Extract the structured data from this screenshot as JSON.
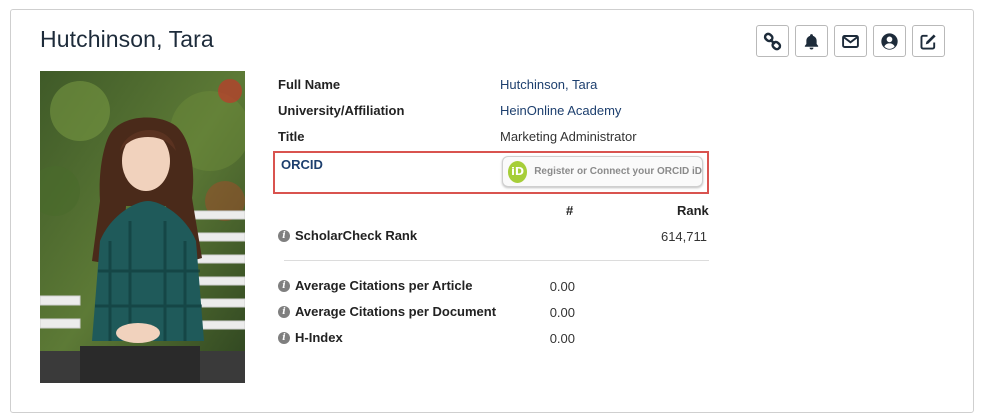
{
  "profile": {
    "name": "Hutchinson, Tara"
  },
  "actions": [
    {
      "icon": "link-icon",
      "label": "Link"
    },
    {
      "icon": "bell-icon",
      "label": "Alerts"
    },
    {
      "icon": "envelope-icon",
      "label": "Email"
    },
    {
      "icon": "user-circle-icon",
      "label": "Profile"
    },
    {
      "icon": "edit-icon",
      "label": "Edit"
    }
  ],
  "fields": {
    "full_name_label": "Full Name",
    "full_name_value": "Hutchinson, Tara",
    "affiliation_label": "University/Affiliation",
    "affiliation_value": "HeinOnline Academy",
    "title_label": "Title",
    "title_value": "Marketing Administrator",
    "orcid_label": "ORCID",
    "orcid_button_text": "Register or Connect your ORCID iD",
    "orcid_logo_text": "iD"
  },
  "rank_table": {
    "col_num": "#",
    "col_rank": "Rank",
    "scholarcheck_label": "ScholarCheck Rank",
    "scholarcheck_rank": "614,711"
  },
  "metrics": [
    {
      "label": "Average Citations per Article",
      "value": "0.00"
    },
    {
      "label": "Average Citations per Document",
      "value": "0.00"
    },
    {
      "label": "H-Index",
      "value": "0.00"
    }
  ],
  "colors": {
    "link_blue": "#1d3f6e",
    "orcid_green": "#a6ce39",
    "highlight_red": "#d9534f"
  }
}
